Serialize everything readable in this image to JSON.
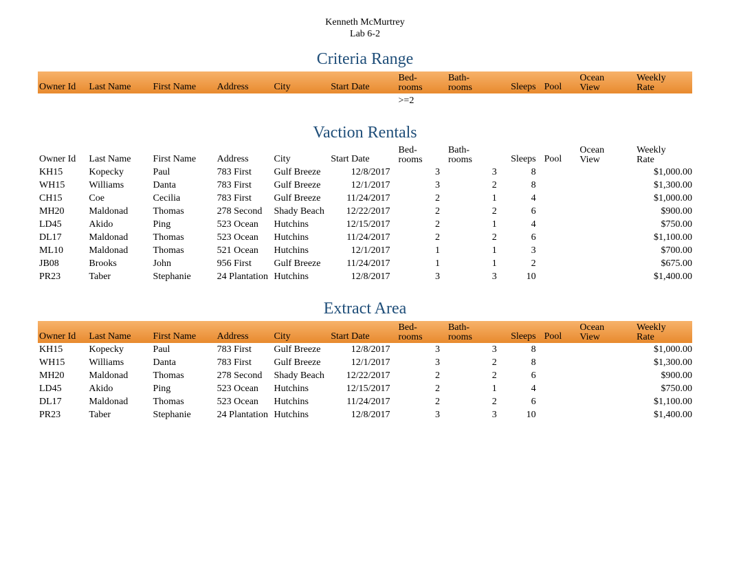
{
  "author": {
    "name": "Kenneth McMurtrey",
    "lab": "Lab 6-2"
  },
  "headers": {
    "owner_id": "Owner Id",
    "last_name": "Last Name",
    "first_name": "First Name",
    "address": "Address",
    "city": "City",
    "start_date": "Start Date",
    "bedrooms_l1": "Bed-",
    "bedrooms_l2": "rooms",
    "bathrooms_l1": "Bath-",
    "bathrooms_l2": "rooms",
    "sleeps": "Sleeps",
    "pool": "Pool",
    "ocean_view_l1": "Ocean",
    "ocean_view_l2": "View",
    "weekly_rate_l1": "Weekly",
    "weekly_rate_l2": "Rate"
  },
  "sections": {
    "criteria_title": "Criteria Range",
    "rentals_title": "Vaction Rentals",
    "extract_title": "Extract Area"
  },
  "criteria_filter": {
    "bathrooms": ">=2"
  },
  "rentals": [
    {
      "owner_id": "KH15",
      "last": "Kopecky",
      "first": "Paul",
      "addr": "783 First",
      "city": "Gulf Breeze",
      "start": "12/8/2017",
      "bed": "3",
      "bath": "3",
      "sleeps": "8",
      "rate": "$1,000.00"
    },
    {
      "owner_id": "WH15",
      "last": "Williams",
      "first": "Danta",
      "addr": "783 First",
      "city": "Gulf Breeze",
      "start": "12/1/2017",
      "bed": "3",
      "bath": "2",
      "sleeps": "8",
      "rate": "$1,300.00"
    },
    {
      "owner_id": "CH15",
      "last": "Coe",
      "first": "Cecilia",
      "addr": "783 First",
      "city": "Gulf Breeze",
      "start": "11/24/2017",
      "bed": "2",
      "bath": "1",
      "sleeps": "4",
      "rate": "$1,000.00"
    },
    {
      "owner_id": "MH20",
      "last": "Maldonad",
      "first": "Thomas",
      "addr": "278 Second",
      "city": "Shady Beach",
      "start": "12/22/2017",
      "bed": "2",
      "bath": "2",
      "sleeps": "6",
      "rate": "$900.00"
    },
    {
      "owner_id": "LD45",
      "last": "Akido",
      "first": "Ping",
      "addr": "523 Ocean",
      "city": "Hutchins",
      "start": "12/15/2017",
      "bed": "2",
      "bath": "1",
      "sleeps": "4",
      "rate": "$750.00"
    },
    {
      "owner_id": "DL17",
      "last": "Maldonad",
      "first": "Thomas",
      "addr": "523 Ocean",
      "city": "Hutchins",
      "start": "11/24/2017",
      "bed": "2",
      "bath": "2",
      "sleeps": "6",
      "rate": "$1,100.00"
    },
    {
      "owner_id": "ML10",
      "last": "Maldonad",
      "first": "Thomas",
      "addr": "521 Ocean",
      "city": "Hutchins",
      "start": "12/1/2017",
      "bed": "1",
      "bath": "1",
      "sleeps": "3",
      "rate": "$700.00"
    },
    {
      "owner_id": "JB08",
      "last": "Brooks",
      "first": "John",
      "addr": "956 First",
      "city": "Gulf Breeze",
      "start": "11/24/2017",
      "bed": "1",
      "bath": "1",
      "sleeps": "2",
      "rate": "$675.00"
    },
    {
      "owner_id": "PR23",
      "last": "Taber",
      "first": "Stephanie",
      "addr": "24 Plantation",
      "city": "Hutchins",
      "start": "12/8/2017",
      "bed": "3",
      "bath": "3",
      "sleeps": "10",
      "rate": "$1,400.00"
    }
  ],
  "extract": [
    {
      "owner_id": "KH15",
      "last": "Kopecky",
      "first": "Paul",
      "addr": "783 First",
      "city": "Gulf Breeze",
      "start": "12/8/2017",
      "bed": "3",
      "bath": "3",
      "sleeps": "8",
      "rate": "$1,000.00"
    },
    {
      "owner_id": "WH15",
      "last": "Williams",
      "first": "Danta",
      "addr": "783 First",
      "city": "Gulf Breeze",
      "start": "12/1/2017",
      "bed": "3",
      "bath": "2",
      "sleeps": "8",
      "rate": "$1,300.00"
    },
    {
      "owner_id": "MH20",
      "last": "Maldonad",
      "first": "Thomas",
      "addr": "278 Second",
      "city": "Shady Beach",
      "start": "12/22/2017",
      "bed": "2",
      "bath": "2",
      "sleeps": "6",
      "rate": "$900.00"
    },
    {
      "owner_id": "LD45",
      "last": "Akido",
      "first": "Ping",
      "addr": "523 Ocean",
      "city": "Hutchins",
      "start": "12/15/2017",
      "bed": "2",
      "bath": "1",
      "sleeps": "4",
      "rate": "$750.00"
    },
    {
      "owner_id": "DL17",
      "last": "Maldonad",
      "first": "Thomas",
      "addr": "523 Ocean",
      "city": "Hutchins",
      "start": "11/24/2017",
      "bed": "2",
      "bath": "2",
      "sleeps": "6",
      "rate": "$1,100.00"
    },
    {
      "owner_id": "PR23",
      "last": "Taber",
      "first": "Stephanie",
      "addr": "24 Plantation",
      "city": "Hutchins",
      "start": "12/8/2017",
      "bed": "3",
      "bath": "3",
      "sleeps": "10",
      "rate": "$1,400.00"
    }
  ]
}
